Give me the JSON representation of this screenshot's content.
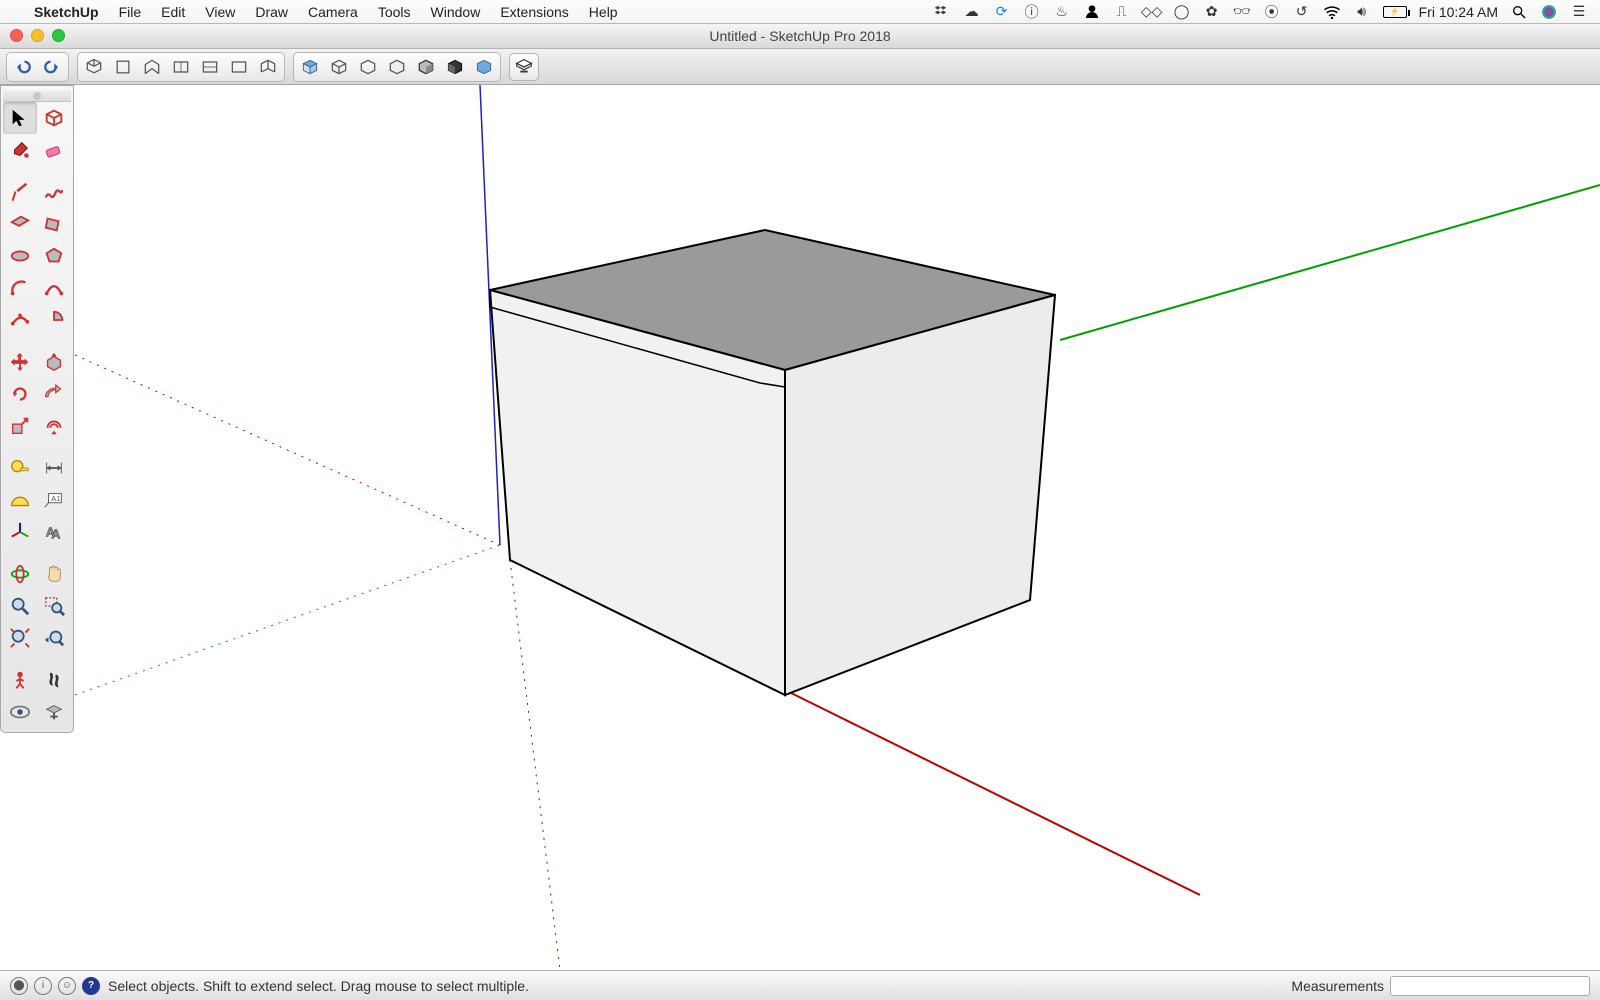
{
  "menubar": {
    "appName": "SketchUp",
    "items": [
      "File",
      "Edit",
      "View",
      "Draw",
      "Camera",
      "Tools",
      "Window",
      "Extensions",
      "Help"
    ],
    "clock": "Fri 10:24 AM"
  },
  "window": {
    "title": "Untitled - SketchUp Pro 2018"
  },
  "toolbarTop": {
    "groups": [
      [
        "undo",
        "redo"
      ],
      [
        "iso",
        "top",
        "front",
        "right",
        "back",
        "left",
        "perspective"
      ],
      [
        "layer1",
        "layer2",
        "layer3",
        "layer4",
        "layer5",
        "layer6",
        "layer7"
      ]
    ],
    "solo": "hint"
  },
  "sideToolbar": {
    "rows": [
      [
        "select",
        "make-component"
      ],
      [
        "paint-bucket",
        "eraser"
      ],
      [
        "sep"
      ],
      [
        "line",
        "freehand"
      ],
      [
        "rectangle",
        "rotated-rectangle"
      ],
      [
        "circle",
        "polygon"
      ],
      [
        "arc",
        "2pt-arc"
      ],
      [
        "3pt-arc",
        "pie"
      ],
      [
        "sep"
      ],
      [
        "move",
        "push-pull"
      ],
      [
        "rotate",
        "follow-me"
      ],
      [
        "scale",
        "offset"
      ],
      [
        "sep"
      ],
      [
        "tape",
        "dimension"
      ],
      [
        "protractor",
        "text"
      ],
      [
        "axes",
        "3d-text"
      ],
      [
        "sep"
      ],
      [
        "orbit",
        "pan"
      ],
      [
        "zoom",
        "zoom-window"
      ],
      [
        "zoom-extents",
        "previous"
      ],
      [
        "sep"
      ],
      [
        "position-camera",
        "walk"
      ],
      [
        "look-around",
        "section-plane"
      ]
    ],
    "active": "select"
  },
  "statusbar": {
    "hint": "Select objects. Shift to extend select. Drag mouse to select multiple.",
    "measurementsLabel": "Measurements"
  }
}
